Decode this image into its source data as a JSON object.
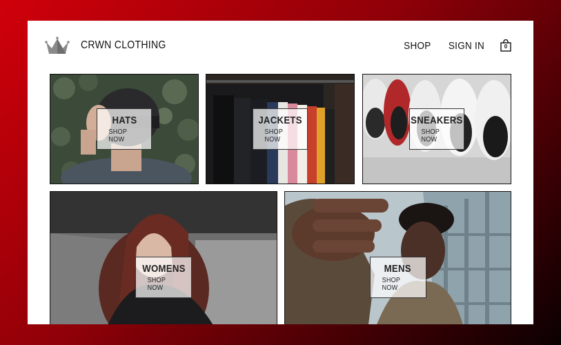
{
  "header": {
    "brand": "CRWN CLOTHING",
    "logo_icon": "crown-icon",
    "nav": {
      "shop": "SHOP",
      "sign_in": "SIGN IN"
    },
    "cart": {
      "icon": "shopping-bag-icon",
      "count": "0"
    }
  },
  "categories": [
    {
      "title": "HATS",
      "cta": "SHOP NOW"
    },
    {
      "title": "JACKETS",
      "cta": "SHOP NOW"
    },
    {
      "title": "SNEAKERS",
      "cta": "SHOP NOW"
    },
    {
      "title": "WOMENS",
      "cta": "SHOP NOW"
    },
    {
      "title": "MENS",
      "cta": "SHOP NOW"
    }
  ],
  "colors": {
    "background_gradient": [
      "#d0000a",
      "#0b0001"
    ],
    "panel": "#ffffff",
    "text": "#111111"
  }
}
